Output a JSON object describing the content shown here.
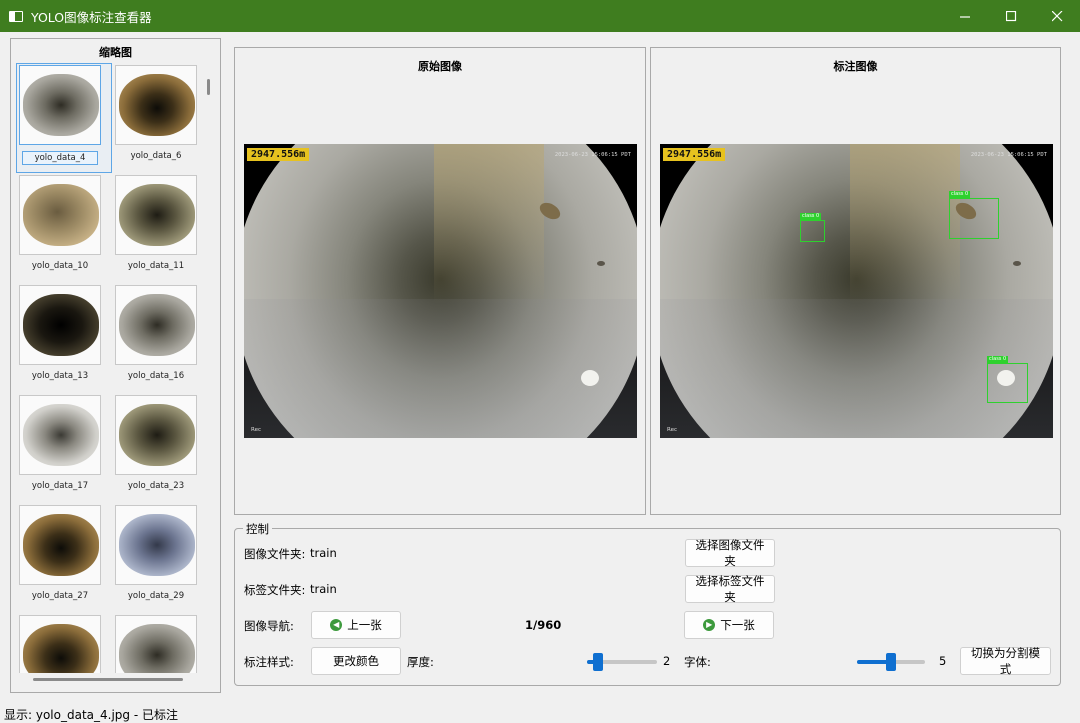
{
  "window": {
    "title": "YOLO图像标注查看器",
    "accent_color": "#3f7d1f"
  },
  "thumbnails": {
    "header": "缩略图",
    "selected_index": 0,
    "items": [
      {
        "label": "yolo_data_4",
        "tone": "gray"
      },
      {
        "label": "yolo_data_6",
        "tone": "brown"
      },
      {
        "label": "yolo_data_10",
        "tone": "tan"
      },
      {
        "label": "yolo_data_11",
        "tone": "olive"
      },
      {
        "label": "yolo_data_13",
        "tone": "dark"
      },
      {
        "label": "yolo_data_16",
        "tone": "gray"
      },
      {
        "label": "yolo_data_17",
        "tone": "light"
      },
      {
        "label": "yolo_data_23",
        "tone": "olive"
      },
      {
        "label": "yolo_data_27",
        "tone": "brown"
      },
      {
        "label": "yolo_data_29",
        "tone": "blue"
      },
      {
        "label": "",
        "tone": "brown"
      },
      {
        "label": "",
        "tone": "gray"
      }
    ]
  },
  "viewer": {
    "original_title": "原始图像",
    "annotated_title": "标注图像",
    "depth_overlay": "2947.556m",
    "timestamp_overlay": "2023-06-23 15:06:15 PDT",
    "rec_overlay": "Rec",
    "boxes": [
      {
        "label": "class 0"
      },
      {
        "label": "class 0"
      },
      {
        "label": "class 0"
      }
    ]
  },
  "controls": {
    "group_title": "控制",
    "image_folder_label": "图像文件夹:",
    "image_folder_value": "train",
    "select_image_folder_button": "选择图像文件夹",
    "label_folder_label": "标签文件夹:",
    "label_folder_value": "train",
    "select_label_folder_button": "选择标签文件夹",
    "navigation_label": "图像导航:",
    "prev_button": "上一张",
    "next_button": "下一张",
    "counter": "1/960",
    "style_label": "标注样式:",
    "change_color_button": "更改颜色",
    "thickness_label": "厚度:",
    "thickness_value": "2",
    "thickness_fraction": 0.1,
    "font_label": "字体:",
    "font_value": "5",
    "font_fraction": 0.5,
    "toggle_mode_button": "切换为分割模式",
    "slider_color": "#0f6fd0"
  },
  "status": {
    "text": "显示: yolo_data_4.jpg - 已标注"
  }
}
